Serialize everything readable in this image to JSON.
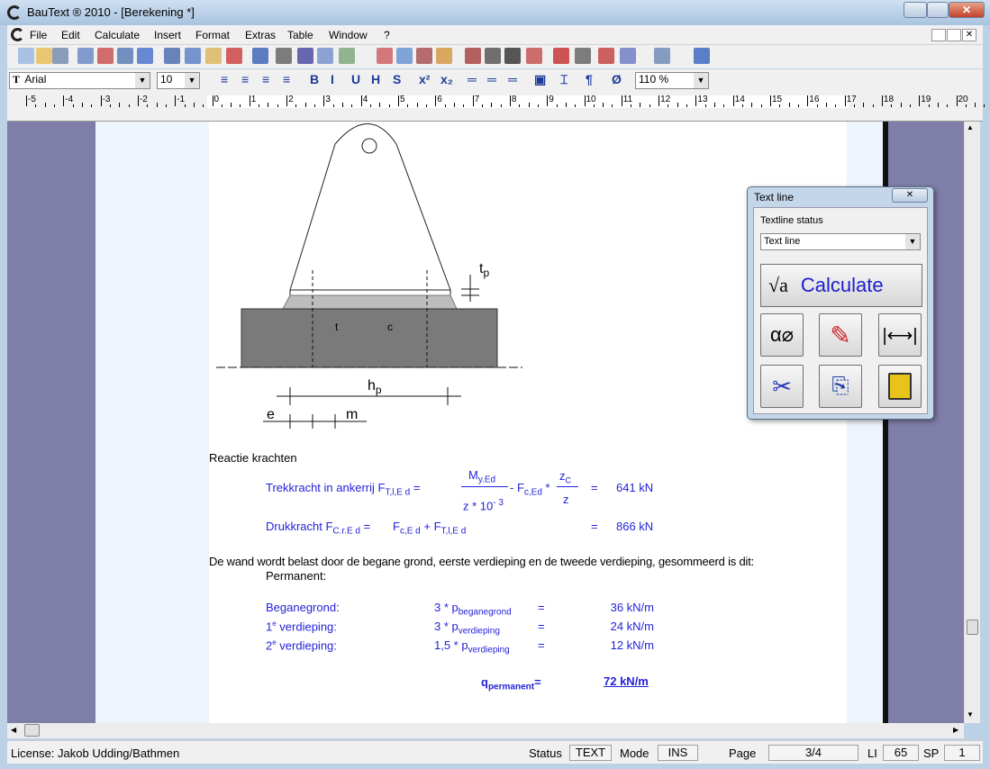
{
  "window": {
    "title": "BauText ® 2010 - [Berekening *]"
  },
  "menu": [
    "File",
    "Edit",
    "Calculate",
    "Insert",
    "Format",
    "Extras",
    "Table",
    "Window",
    "?"
  ],
  "format_toolbar": {
    "font": "Arial",
    "size": "10",
    "zoom": "110 %"
  },
  "ruler": {
    "ticks": [
      "-5",
      "-4",
      "-3",
      "-2",
      "-1",
      "0",
      "1",
      "2",
      "3",
      "4",
      "5",
      "6",
      "7",
      "8",
      "9",
      "10",
      "11",
      "12",
      "13",
      "14",
      "15",
      "16",
      "17",
      "18",
      "19",
      "20"
    ]
  },
  "drawing": {
    "labels": {
      "tp": "t",
      "tp_sub": "p",
      "t": "t",
      "c": "c",
      "hp": "h",
      "hp_sub": "p",
      "e": "e",
      "m": "m"
    }
  },
  "document": {
    "heading": "Reactie krachten",
    "trek": {
      "label": "Trekkracht in ankerrij F",
      "label_sub": "T,l,E d",
      "eq": "=",
      "num": "M",
      "num_sub": "y.Ed",
      "den": "z * 10",
      "den_sup": "- 3",
      "minus": "- F",
      "f_sub": "c,Ed",
      "times": "*",
      "frac_num": "z",
      "frac_num_sub": "C",
      "frac_den": "z",
      "result_eq": "=",
      "result": "641 kN"
    },
    "druk": {
      "label": "Drukkracht F",
      "label_sub": "C.r.E d",
      "eq": "=",
      "f1": "F",
      "f1_sub": "c,E d",
      "plus": "+ F",
      "f2_sub": "T,l,E d",
      "result_eq": "=",
      "result": "866 kN"
    },
    "paragraph": "De wand wordt belast door de begane grond, eerste verdieping en de tweede verdieping, gesommeerd is dit:",
    "permanent": "Permanent:",
    "loads": [
      {
        "label": "Beganegrond:",
        "sup": "",
        "f": "3 * p",
        "f_sub": "beganegrond",
        "eq": "=",
        "value": "36 kN/m"
      },
      {
        "label": "1",
        "sup": "e",
        "label_rest": " verdieping:",
        "f": "3 * p",
        "f_sub": "verdieping",
        "eq": "=",
        "value": "24 kN/m"
      },
      {
        "label": "2",
        "sup": "e",
        "label_rest": " verdieping:",
        "f": "1,5 * p",
        "f_sub": "verdieping",
        "eq": "=",
        "value": "12 kN/m"
      }
    ],
    "total": {
      "label": "q",
      "label_sub": "permanent",
      "eq": "=",
      "value": "72 kN/m"
    }
  },
  "panel": {
    "title": "Text line",
    "status_label": "Textline status",
    "status_value": "Text line",
    "calculate": "Calculate",
    "buttons": [
      "alpha-slash-icon",
      "pencil-icon",
      "width-arrows-icon",
      "scissors-icon",
      "copy-icon",
      "paste-icon"
    ]
  },
  "statusbar": {
    "license": "License: Jakob Udding/Bathmen",
    "status_label": "Status",
    "status": "TEXT",
    "mode_label": "Mode",
    "mode": "INS",
    "page_label": "Page",
    "page": "3/4",
    "li_label": "LI",
    "li": "65",
    "sp_label": "SP",
    "sp": "1"
  },
  "colors": {
    "text_blue": "#2323d8",
    "doc_bg": "#7f7ea8",
    "plate": "#7a7a7a"
  }
}
